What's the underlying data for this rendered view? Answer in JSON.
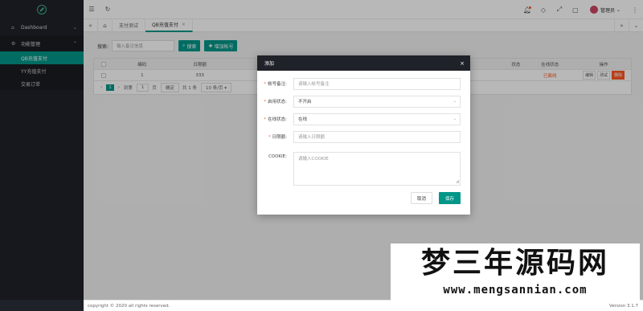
{
  "sidebar": {
    "items": [
      {
        "label": "Dashboard",
        "icon": "home-icon"
      },
      {
        "label": "功能管理",
        "icon": "gear-icon"
      }
    ],
    "subitems": [
      {
        "label": "QB充值支付",
        "active": true
      },
      {
        "label": "YY充值支付",
        "active": false
      },
      {
        "label": "交易订单",
        "active": false
      }
    ]
  },
  "header": {
    "user": "管理员"
  },
  "tabs": [
    {
      "label": "支付测试"
    },
    {
      "label": "QB充值支付",
      "active": true
    }
  ],
  "toolbar": {
    "search_label": "搜索:",
    "search_placeholder": "输入备注信息",
    "search_button": "搜索",
    "add_button": "增加帐号"
  },
  "table": {
    "columns": [
      "编码",
      "日限额",
      "在线状态",
      "操作"
    ],
    "hidden_column_label": "状态",
    "rows": [
      {
        "id": "1",
        "limit": "333",
        "status_tag": "",
        "online": "已离线"
      }
    ],
    "actions": [
      "编辑",
      "测试",
      "删除"
    ]
  },
  "pager": {
    "current": "1",
    "goto_label": "到第",
    "goto_value": "1",
    "page_unit": "页",
    "confirm": "确定",
    "total": "共 1 条",
    "per_page": "10 条/页"
  },
  "modal": {
    "title": "添加",
    "fields": [
      {
        "label": "帐号备注:",
        "required": true,
        "placeholder": "请输入帐号备注"
      },
      {
        "label": "启用状态:",
        "required": true,
        "value": "不开启"
      },
      {
        "label": "在线状态:",
        "required": true,
        "value": "在线"
      },
      {
        "label": "日限额:",
        "required": true,
        "placeholder": "请输入日限额"
      },
      {
        "label": "COOKIE:",
        "required": false,
        "placeholder": "请输入COOKIE"
      }
    ],
    "cancel_label": "取消",
    "save_label": "保存"
  },
  "footer": {
    "copyright": "copyright © 2020 all rights reserved.",
    "version": "Version 3.1.7"
  },
  "watermark": {
    "title": "梦三年源码网",
    "url": "www.mengsannian.com"
  },
  "colors": {
    "accent": "#009688",
    "sidebar_bg": "#20222a",
    "danger": "#ff5722"
  }
}
